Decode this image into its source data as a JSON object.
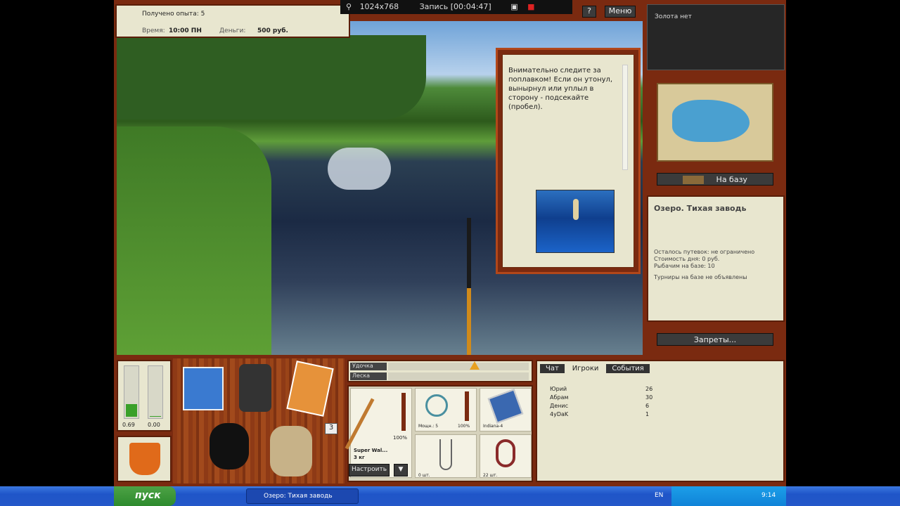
{
  "recorder": {
    "resolution": "1024x768",
    "recording": "Запись [00:04:47]"
  },
  "status": {
    "experience": "Получено опыта: 5",
    "time_label": "Время:",
    "time_value": "10:00 ПН",
    "money_label": "Деньги:",
    "money_value": "500 руб."
  },
  "top_buttons": {
    "help": "?",
    "menu": "Меню"
  },
  "gold": {
    "text": "Золота нет"
  },
  "hint": {
    "text": "Внимательно следите за поплавком! Если он утонул, вынырнул или уплыл в сторону - подсекайте (пробел)."
  },
  "base_button": "На базу",
  "location": {
    "title": "Озеро. Тихая заводь",
    "trips": "Осталось путевок: не ограничено",
    "cost": "Стоимость дня: 0 руб.",
    "days": "Рыбачим на базе: 10",
    "tournaments": "Турниры на базе не объявлены"
  },
  "bans_button": "Запреты...",
  "tackle": {
    "rod_label": "Удочка",
    "line_label": "Леска",
    "warning_icon": "warning-icon"
  },
  "gauges": {
    "left_value": "0.69",
    "right_value": "0.00",
    "left_level": 0.25,
    "right_level": 0.02
  },
  "rod": {
    "name": "Super Wal...",
    "weight": "3 кг",
    "strength": "100%"
  },
  "reel": {
    "name": "Мощн.: 5",
    "strength": "100%"
  },
  "line": {
    "name": "Indiana-4"
  },
  "hook": {
    "count": "0 шт."
  },
  "bait": {
    "count": "22 шт."
  },
  "setup_button": "Настроить",
  "dropdown_button": "▼",
  "inventory_badge": "3",
  "tabs": [
    "Чат",
    "Игроки",
    "События"
  ],
  "players": [
    {
      "name": "Юрий",
      "score": "26"
    },
    {
      "name": "Абрам",
      "score": "30"
    },
    {
      "name": "Денис",
      "score": "6"
    },
    {
      "name": "4yDaK",
      "score": "1"
    }
  ],
  "taskbar": {
    "start": "пуск",
    "window": "Озеро: Тихая заводь",
    "lang": "EN",
    "clock": "9:14"
  },
  "colors": {
    "wood": "#8e3a16",
    "parchment": "#e8e6cf",
    "taskbar": "#245edb",
    "start": "#3c9a3a"
  }
}
